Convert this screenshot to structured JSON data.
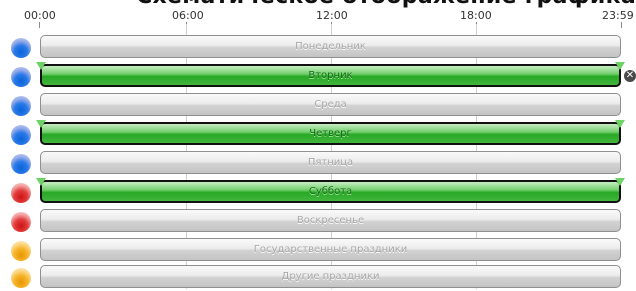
{
  "page": {
    "title": "Схематическое отображение графика"
  },
  "timeline": {
    "labels": [
      "00:00",
      "06:00",
      "12:00",
      "18:00",
      "23:59"
    ]
  },
  "schedule": {
    "rows": [
      {
        "label": "Понедельник",
        "dot_color": "blue",
        "active": false
      },
      {
        "label": "Вторник",
        "dot_color": "blue",
        "active": true
      },
      {
        "label": "Среда",
        "dot_color": "blue",
        "active": false
      },
      {
        "label": "Четверг",
        "dot_color": "blue",
        "active": true
      },
      {
        "label": "Пятница",
        "dot_color": "blue",
        "active": false
      },
      {
        "label": "Суббота",
        "dot_color": "red",
        "active": true
      },
      {
        "label": "Воскресенье",
        "dot_color": "red",
        "active": false
      },
      {
        "label": "Государственные праздники",
        "dot_color": "orange",
        "active": false
      },
      {
        "label": "Другие праздники",
        "dot_color": "orange",
        "active": false
      }
    ],
    "close_icon": "close-icon",
    "colors": {
      "blue": "#1f6fe0",
      "red": "#e02a2a",
      "orange": "#f2a20d",
      "active_green": "#2fab2c",
      "inactive_gray": "#cfcfcf"
    }
  }
}
